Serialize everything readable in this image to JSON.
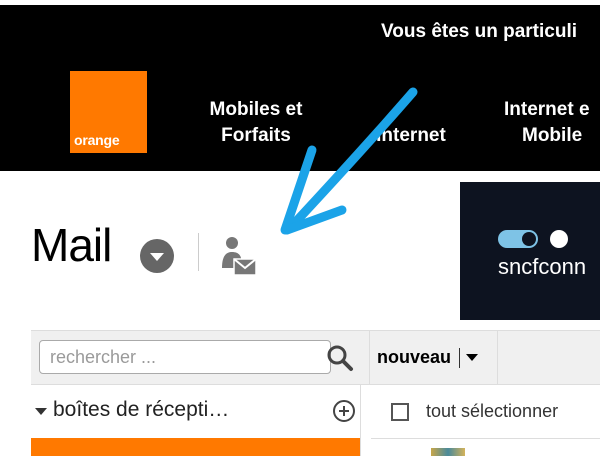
{
  "header": {
    "banner": "Vous êtes un particuli",
    "logo_text": "orange",
    "nav": {
      "mobiles_line1": "Mobiles et",
      "mobiles_line2": "Forfaits",
      "internet": "Internet",
      "internet_mobile_line1": "Internet e",
      "internet_mobile_line2": "Mobile"
    }
  },
  "mail": {
    "title": "Mail"
  },
  "ad": {
    "text": "sncfconn"
  },
  "toolbar": {
    "search_placeholder": "rechercher ...",
    "new_label": "nouveau"
  },
  "sidebar": {
    "boxes_label": "boîtes de récepti…"
  },
  "list": {
    "select_all_label": "tout sélectionner"
  },
  "colors": {
    "brand_orange": "#ff7900",
    "arrow_blue": "#1ba3e8",
    "header_bg": "#000000"
  }
}
